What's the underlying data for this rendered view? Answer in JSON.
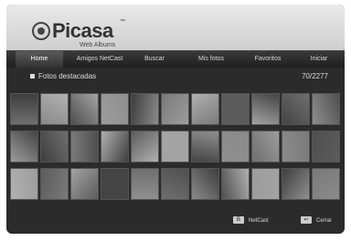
{
  "app": {
    "logo_name": "Picasa",
    "logo_tm": "™",
    "logo_sub": "Web Albums"
  },
  "nav": {
    "tabs": [
      {
        "label": "Home",
        "active": true
      },
      {
        "label": "Amigos NetCast",
        "active": false
      },
      {
        "label": "Buscar",
        "active": false
      },
      {
        "label": "Mis fotos",
        "active": false
      },
      {
        "label": "Favoritos",
        "active": false
      },
      {
        "label": "Iniciar",
        "active": false
      }
    ]
  },
  "section": {
    "title": "Fotos destacadas",
    "count": "70/2277"
  },
  "footer": {
    "netcast_key": "B",
    "netcast_label": "NetCast",
    "close_label": "Cerrar"
  },
  "thumbnail_count": 33
}
